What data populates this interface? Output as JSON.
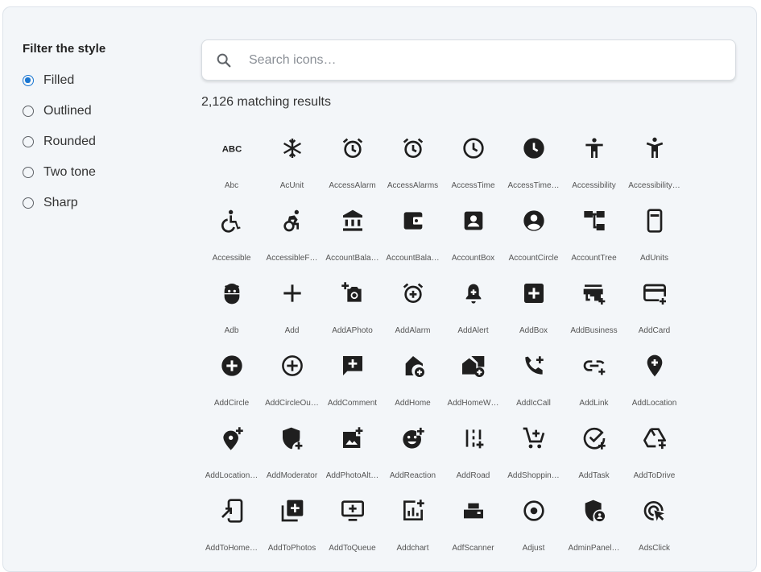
{
  "sidebar": {
    "title": "Filter the style",
    "options": [
      {
        "label": "Filled",
        "checked": true
      },
      {
        "label": "Outlined",
        "checked": false
      },
      {
        "label": "Rounded",
        "checked": false
      },
      {
        "label": "Two tone",
        "checked": false
      },
      {
        "label": "Sharp",
        "checked": false
      }
    ]
  },
  "search": {
    "placeholder": "Search icons…",
    "value": "",
    "icon": "search-icon"
  },
  "results": {
    "text": "2,126 matching results"
  },
  "colors": {
    "accent": "#1976d2",
    "icon": "#1f1f1f",
    "background": "#f3f6f9"
  },
  "icons": [
    {
      "label": "Abc",
      "icon": "abc"
    },
    {
      "label": "AcUnit",
      "icon": "ac-unit"
    },
    {
      "label": "AccessAlarm",
      "icon": "access-alarm"
    },
    {
      "label": "AccessAlarms",
      "icon": "access-alarms"
    },
    {
      "label": "AccessTime",
      "icon": "access-time"
    },
    {
      "label": "AccessTime…",
      "icon": "access-time-filled"
    },
    {
      "label": "Accessibility",
      "icon": "accessibility"
    },
    {
      "label": "Accessibility…",
      "icon": "accessibility-new"
    },
    {
      "label": "Accessible",
      "icon": "accessible"
    },
    {
      "label": "AccessibleF…",
      "icon": "accessible-forward"
    },
    {
      "label": "AccountBala…",
      "icon": "account-balance"
    },
    {
      "label": "AccountBala…",
      "icon": "account-balance-wallet"
    },
    {
      "label": "AccountBox",
      "icon": "account-box"
    },
    {
      "label": "AccountCircle",
      "icon": "account-circle"
    },
    {
      "label": "AccountTree",
      "icon": "account-tree"
    },
    {
      "label": "AdUnits",
      "icon": "ad-units"
    },
    {
      "label": "Adb",
      "icon": "adb"
    },
    {
      "label": "Add",
      "icon": "add"
    },
    {
      "label": "AddAPhoto",
      "icon": "add-a-photo"
    },
    {
      "label": "AddAlarm",
      "icon": "add-alarm"
    },
    {
      "label": "AddAlert",
      "icon": "add-alert"
    },
    {
      "label": "AddBox",
      "icon": "add-box"
    },
    {
      "label": "AddBusiness",
      "icon": "add-business"
    },
    {
      "label": "AddCard",
      "icon": "add-card"
    },
    {
      "label": "AddCircle",
      "icon": "add-circle"
    },
    {
      "label": "AddCircleOu…",
      "icon": "add-circle-outline"
    },
    {
      "label": "AddComment",
      "icon": "add-comment"
    },
    {
      "label": "AddHome",
      "icon": "add-home"
    },
    {
      "label": "AddHomeW…",
      "icon": "add-home-work"
    },
    {
      "label": "AddIcCall",
      "icon": "add-ic-call"
    },
    {
      "label": "AddLink",
      "icon": "add-link"
    },
    {
      "label": "AddLocation",
      "icon": "add-location"
    },
    {
      "label": "AddLocation…",
      "icon": "add-location-alt"
    },
    {
      "label": "AddModerator",
      "icon": "add-moderator"
    },
    {
      "label": "AddPhotoAlt…",
      "icon": "add-photo-alternate"
    },
    {
      "label": "AddReaction",
      "icon": "add-reaction"
    },
    {
      "label": "AddRoad",
      "icon": "add-road"
    },
    {
      "label": "AddShoppin…",
      "icon": "add-shopping-cart"
    },
    {
      "label": "AddTask",
      "icon": "add-task"
    },
    {
      "label": "AddToDrive",
      "icon": "add-to-drive"
    },
    {
      "label": "AddToHome…",
      "icon": "add-to-home-screen"
    },
    {
      "label": "AddToPhotos",
      "icon": "add-to-photos"
    },
    {
      "label": "AddToQueue",
      "icon": "add-to-queue"
    },
    {
      "label": "Addchart",
      "icon": "addchart"
    },
    {
      "label": "AdfScanner",
      "icon": "adf-scanner"
    },
    {
      "label": "Adjust",
      "icon": "adjust"
    },
    {
      "label": "AdminPanel…",
      "icon": "admin-panel-settings"
    },
    {
      "label": "AdsClick",
      "icon": "ads-click"
    }
  ]
}
